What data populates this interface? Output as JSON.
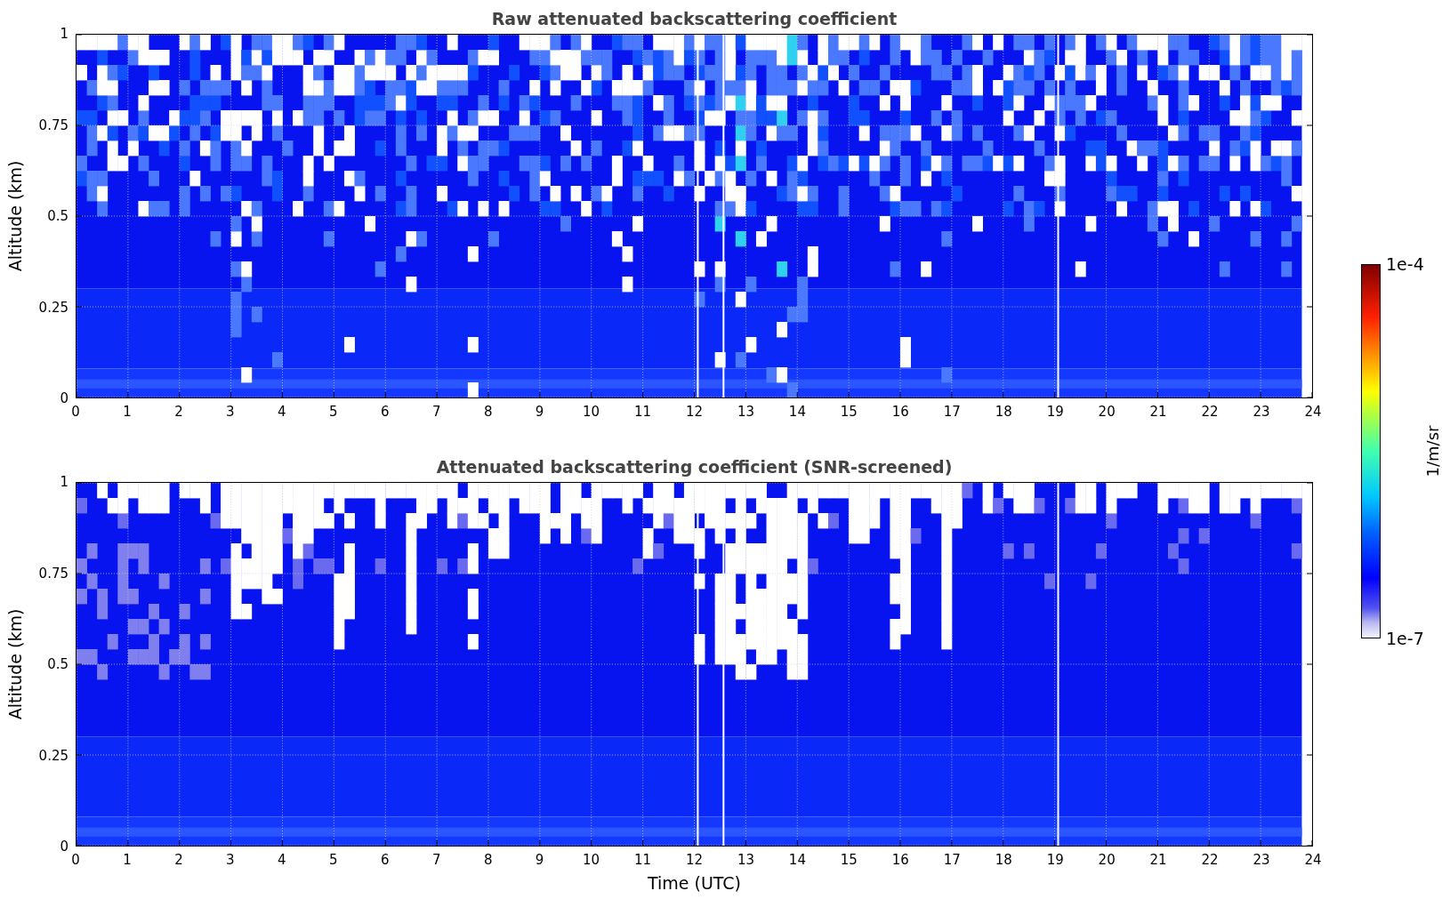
{
  "panels": [
    {
      "kind": "raw",
      "title": "Raw attenuated backscattering coefficient",
      "ylabel": "Altitude (km)",
      "yticks": [
        "1",
        "0.75",
        "0.5",
        "0.25",
        "0"
      ],
      "xticks": [
        "0",
        "1",
        "2",
        "3",
        "4",
        "5",
        "6",
        "7",
        "8",
        "9",
        "10",
        "11",
        "12",
        "13",
        "14",
        "15",
        "16",
        "17",
        "18",
        "19",
        "20",
        "21",
        "22",
        "23",
        "24"
      ]
    },
    {
      "kind": "screened",
      "title": "Attenuated backscattering coefficient (SNR-screened)",
      "ylabel": "Altitude (km)",
      "xlabel": "Time (UTC)",
      "yticks": [
        "1",
        "0.75",
        "0.5",
        "0.25",
        "0"
      ],
      "xticks": [
        "0",
        "1",
        "2",
        "3",
        "4",
        "5",
        "6",
        "7",
        "8",
        "9",
        "10",
        "11",
        "12",
        "13",
        "14",
        "15",
        "16",
        "17",
        "18",
        "19",
        "20",
        "21",
        "22",
        "23",
        "24"
      ]
    }
  ],
  "colorbar": {
    "label": "1/m/sr",
    "max_label": "1e-4",
    "min_label": "1e-7"
  }
}
